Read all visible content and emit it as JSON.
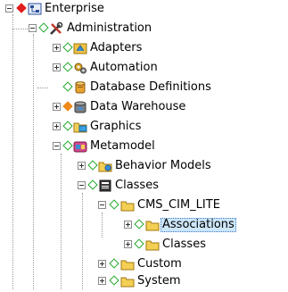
{
  "tree": {
    "enterprise": "Enterprise",
    "administration": "Administration",
    "adapters": "Adapters",
    "automation": "Automation",
    "database_definitions": "Database Definitions",
    "data_warehouse": "Data Warehouse",
    "graphics": "Graphics",
    "metamodel": "Metamodel",
    "behavior_models": "Behavior Models",
    "classes": "Classes",
    "cms_cim_lite": "CMS_CIM_LITE",
    "associations": "Associations",
    "classes_sub": "Classes",
    "custom": "Custom",
    "system": "System"
  },
  "colors": {
    "diamond_green": "#21a82a",
    "diamond_red": "#e01e1e",
    "diamond_orange": "#ef8a1a",
    "selection_bg": "#cde6fa",
    "folder": "#f3cf55"
  },
  "icons": {
    "enterprise": "network-tree-icon",
    "administration": "tools-icon",
    "adapters": "adapter-puzzle-icon",
    "automation": "gears-icon",
    "database_definitions": "database-icon",
    "data_warehouse": "warehouse-icon",
    "graphics": "graphics-folder-icon",
    "metamodel": "metamodel-icon",
    "behavior_models": "behavior-folder-icon",
    "classes": "classes-icon",
    "folder": "folder-icon"
  }
}
